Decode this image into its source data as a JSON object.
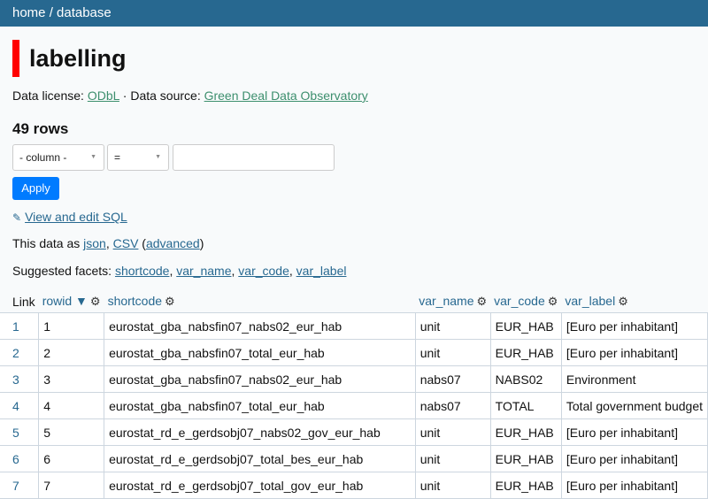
{
  "breadcrumb": "home / database",
  "title": "labelling",
  "license": {
    "license_prefix": "Data license: ",
    "license_link": "ODbL",
    "separator": " · Data source: ",
    "source_link": "Green Deal Data Observatory"
  },
  "rowcount": "49 rows",
  "filter": {
    "column_label": "- column -",
    "op_label": "=",
    "value": "",
    "apply_label": "Apply"
  },
  "sql_link": "View and edit SQL",
  "data_as": {
    "prefix": "This data as ",
    "json": "json",
    "comma": ", ",
    "csv": "CSV",
    "open": " (",
    "advanced": "advanced",
    "close": ")"
  },
  "facets": {
    "prefix": "Suggested facets: ",
    "items": [
      "shortcode",
      "var_name",
      "var_code",
      "var_label"
    ]
  },
  "table": {
    "headers": {
      "link": "Link",
      "rowid": "rowid",
      "sort_indicator": "▼",
      "shortcode": "shortcode",
      "var_name": "var_name",
      "var_code": "var_code",
      "var_label": "var_label"
    },
    "rows": [
      {
        "link": "1",
        "rowid": "1",
        "shortcode": "eurostat_gba_nabsfin07_nabs02_eur_hab",
        "var_name": "unit",
        "var_code": "EUR_HAB",
        "var_label": "[Euro per inhabitant]"
      },
      {
        "link": "2",
        "rowid": "2",
        "shortcode": "eurostat_gba_nabsfin07_total_eur_hab",
        "var_name": "unit",
        "var_code": "EUR_HAB",
        "var_label": "[Euro per inhabitant]"
      },
      {
        "link": "3",
        "rowid": "3",
        "shortcode": "eurostat_gba_nabsfin07_nabs02_eur_hab",
        "var_name": "nabs07",
        "var_code": "NABS02",
        "var_label": "Environment"
      },
      {
        "link": "4",
        "rowid": "4",
        "shortcode": "eurostat_gba_nabsfin07_total_eur_hab",
        "var_name": "nabs07",
        "var_code": "TOTAL",
        "var_label": "Total government budget"
      },
      {
        "link": "5",
        "rowid": "5",
        "shortcode": "eurostat_rd_e_gerdsobj07_nabs02_gov_eur_hab",
        "var_name": "unit",
        "var_code": "EUR_HAB",
        "var_label": "[Euro per inhabitant]"
      },
      {
        "link": "6",
        "rowid": "6",
        "shortcode": "eurostat_rd_e_gerdsobj07_total_bes_eur_hab",
        "var_name": "unit",
        "var_code": "EUR_HAB",
        "var_label": "[Euro per inhabitant]"
      },
      {
        "link": "7",
        "rowid": "7",
        "shortcode": "eurostat_rd_e_gerdsobj07_total_gov_eur_hab",
        "var_name": "unit",
        "var_code": "EUR_HAB",
        "var_label": "[Euro per inhabitant]"
      }
    ]
  },
  "colors": {
    "header_bg": "#276890",
    "accent_bar": "#ff0000",
    "apply_bg": "#007bff",
    "link": "#276890",
    "license_link": "#3d8f6e"
  }
}
